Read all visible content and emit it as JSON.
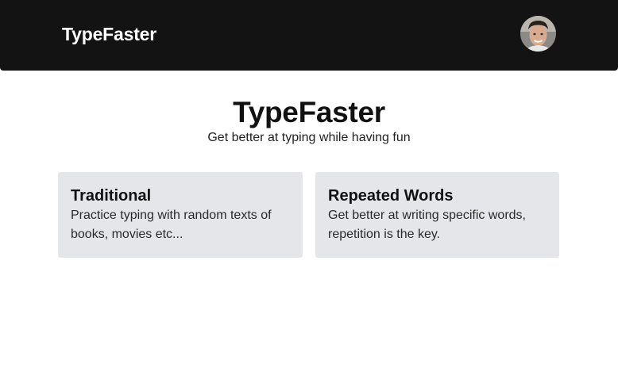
{
  "navbar": {
    "brand": "TypeFaster",
    "background": "#131313"
  },
  "hero": {
    "title": "TypeFaster",
    "subtitle": "Get better at typing while having fun"
  },
  "modes": [
    {
      "title": "Traditional",
      "description": "Practice typing with random texts of books, movies etc..."
    },
    {
      "title": "Repeated Words",
      "description": "Get better at writing specific words, repetition is the key."
    }
  ],
  "colors": {
    "card_background": "#e5e6ea",
    "text": "#111111"
  },
  "icons": {
    "avatar": "user-avatar-icon"
  }
}
